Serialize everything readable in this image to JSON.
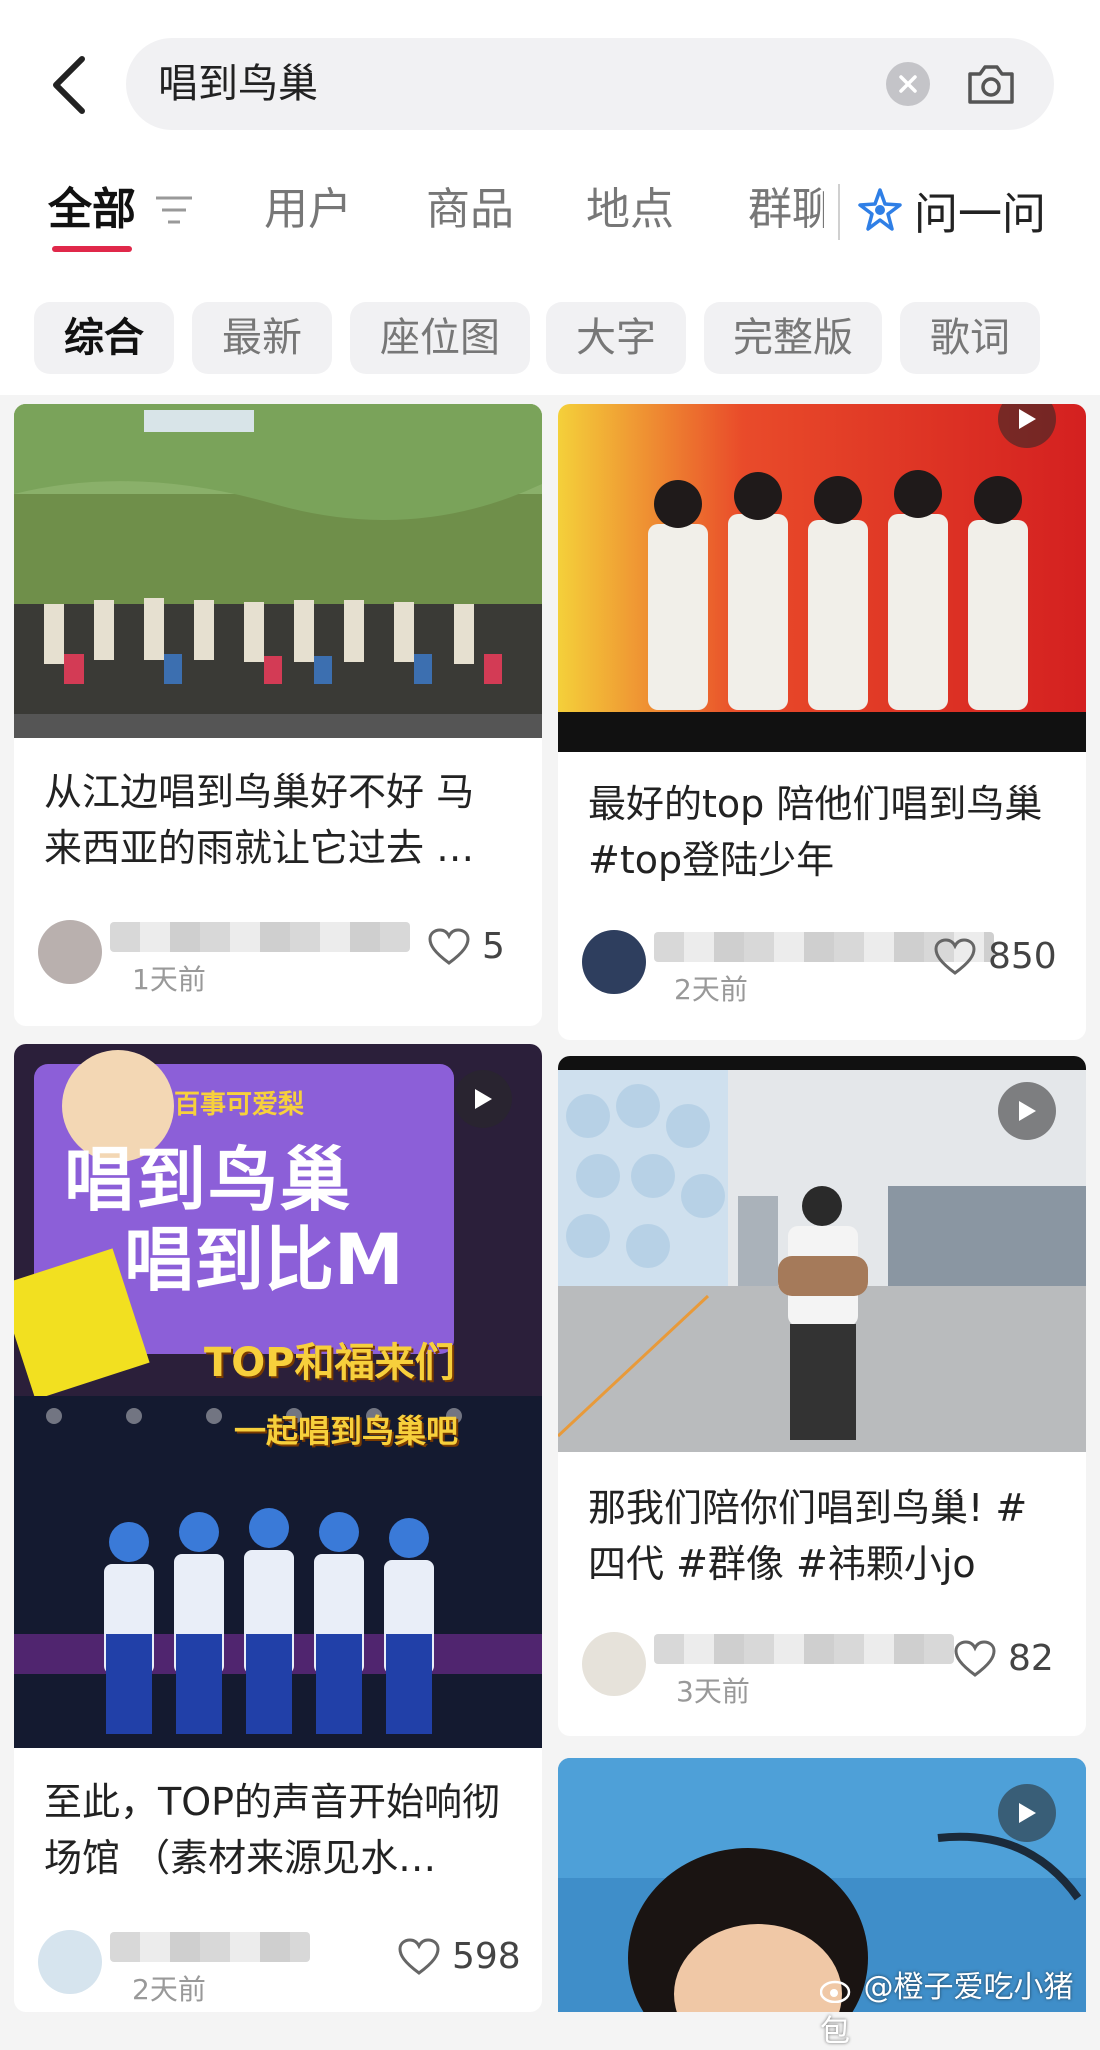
{
  "search": {
    "query": "唱到鸟巢"
  },
  "tabs": [
    {
      "label": "全部"
    },
    {
      "label": "用户"
    },
    {
      "label": "商品"
    },
    {
      "label": "地点"
    },
    {
      "label": "群聊"
    }
  ],
  "ask": {
    "label": "问一问"
  },
  "chips": [
    {
      "label": "综合"
    },
    {
      "label": "最新"
    },
    {
      "label": "座位图"
    },
    {
      "label": "大字"
    },
    {
      "label": "完整版"
    },
    {
      "label": "歌词"
    }
  ],
  "cards": [
    {
      "title": "从江边唱到鸟巢好不好 马来西亚的雨就让它过去 …",
      "time": "1天前",
      "likes": "5",
      "video": false
    },
    {
      "title": "最好的top 陪他们唱到鸟巢 #top登陆少年",
      "time": "2天前",
      "likes": "850",
      "video": true
    },
    {
      "title": "至此，TOP的声音开始响彻场馆 （素材来源见水…",
      "time": "2天前",
      "likes": "598",
      "video": true,
      "overlay_text": {
        "line1": "唱到鸟巢",
        "line2": "唱到比M",
        "line3": "TOP和福来们",
        "line4": "一起唱到鸟巢吧",
        "badge": "百事可爱梨"
      }
    },
    {
      "title": "那我们陪你们唱到鸟巢! #四代 #群像 #祎颗小jo",
      "time": "3天前",
      "likes": "82",
      "video": true
    },
    {
      "title": "",
      "time": "",
      "likes": "",
      "video": true
    }
  ],
  "watermark": "@橙子爱吃小猪包",
  "colors": {
    "accent": "#e0284a",
    "ask_icon": "#2f7fe6"
  },
  "icons": [
    "chevron-left-icon",
    "clear-icon",
    "camera-icon",
    "filter-icon",
    "ask-star-icon",
    "play-icon",
    "heart-icon",
    "weibo-icon"
  ]
}
